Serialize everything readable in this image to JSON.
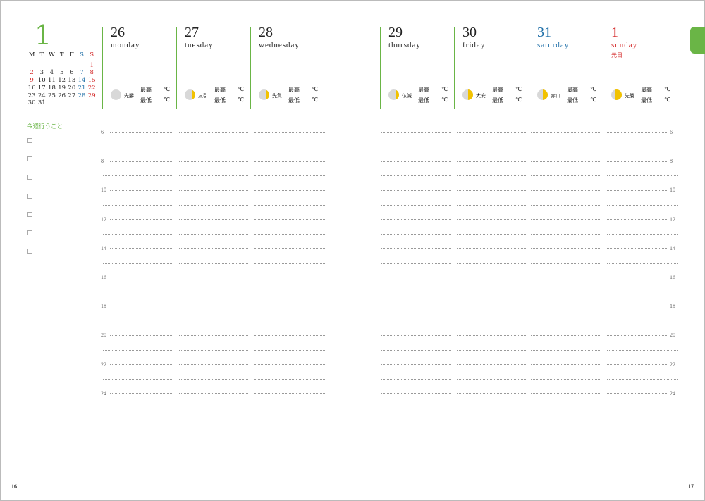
{
  "month": "1",
  "mini_calendar": {
    "weekdays": [
      "M",
      "T",
      "W",
      "T",
      "F",
      "S",
      "S"
    ],
    "weeks": [
      [
        "",
        "",
        "",
        "",
        "",
        "",
        "1"
      ],
      [
        "2",
        "3",
        "4",
        "5",
        "6",
        "7",
        "8"
      ],
      [
        "9",
        "10",
        "11",
        "12",
        "13",
        "14",
        "15"
      ],
      [
        "16",
        "17",
        "18",
        "19",
        "20",
        "21",
        "22"
      ],
      [
        "23",
        "24",
        "25",
        "26",
        "27",
        "28",
        "29"
      ],
      [
        "30",
        "31",
        "",
        "",
        "",
        "",
        ""
      ]
    ],
    "holiday_dates": [
      "1",
      "2",
      "9"
    ]
  },
  "week_tasks_label": "今週行うこと",
  "temp_high_label": "最高",
  "temp_low_label": "最低",
  "temp_unit": "℃",
  "days": [
    {
      "num": "26",
      "name": "monday",
      "holiday": "",
      "rokuyo": "先勝",
      "moon_phase": "new",
      "type": "weekday"
    },
    {
      "num": "27",
      "name": "tuesday",
      "holiday": "",
      "rokuyo": "友引",
      "moon_phase": "waxing-crescent",
      "type": "weekday"
    },
    {
      "num": "28",
      "name": "wednesday",
      "holiday": "",
      "rokuyo": "先負",
      "moon_phase": "waxing-crescent",
      "type": "weekday"
    },
    {
      "num": "29",
      "name": "thursday",
      "holiday": "",
      "rokuyo": "仏滅",
      "moon_phase": "waxing-crescent",
      "type": "weekday"
    },
    {
      "num": "30",
      "name": "friday",
      "holiday": "",
      "rokuyo": "大安",
      "moon_phase": "first-quarter",
      "type": "weekday"
    },
    {
      "num": "31",
      "name": "saturday",
      "holiday": "",
      "rokuyo": "赤口",
      "moon_phase": "first-quarter",
      "type": "sat"
    },
    {
      "num": "1",
      "name": "sunday",
      "holiday": "元日",
      "rokuyo": "先勝",
      "moon_phase": "waxing-gibbous",
      "type": "sun"
    }
  ],
  "hours": [
    "6",
    "8",
    "10",
    "12",
    "14",
    "16",
    "18",
    "20",
    "22",
    "24"
  ],
  "page_left": "16",
  "page_right": "17",
  "colors": {
    "accent": "#6ab546",
    "saturday": "#1f6fa8",
    "sunday": "#d42a2a",
    "moon_lit": "#f2c200",
    "moon_dark": "#d8d8d8"
  }
}
